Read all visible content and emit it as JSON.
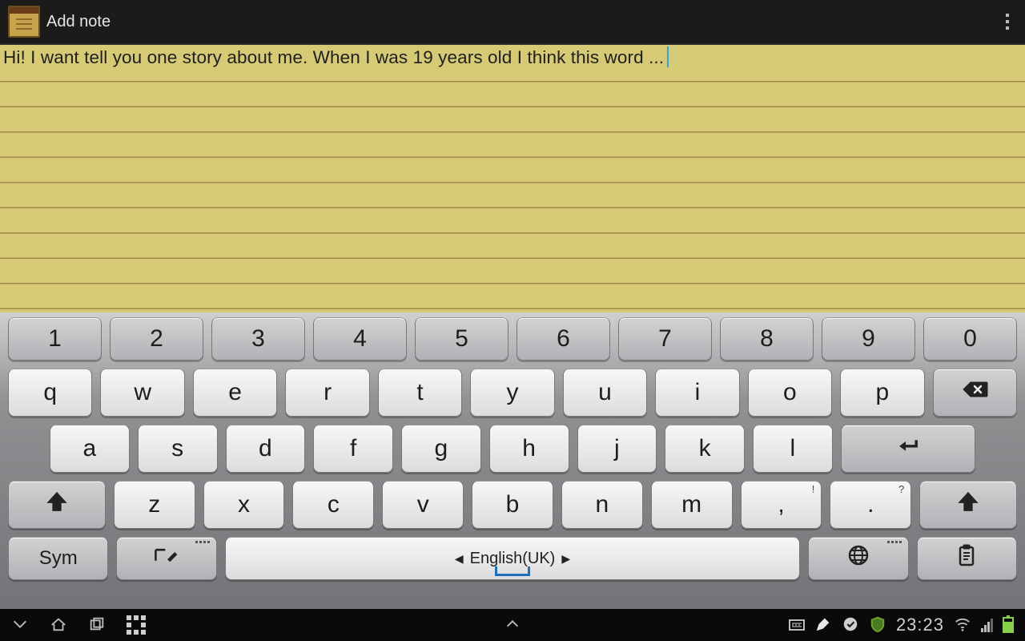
{
  "appbar": {
    "title": "Add note"
  },
  "note": {
    "text": "Hi! I want tell you one story about me. When I was 19 years old I think this word ..."
  },
  "keyboard": {
    "row_num": [
      "1",
      "2",
      "3",
      "4",
      "5",
      "6",
      "7",
      "8",
      "9",
      "0"
    ],
    "row_q": [
      "q",
      "w",
      "e",
      "r",
      "t",
      "y",
      "u",
      "i",
      "o",
      "p"
    ],
    "row_a": [
      "a",
      "s",
      "d",
      "f",
      "g",
      "h",
      "j",
      "k",
      "l"
    ],
    "row_z": [
      "z",
      "x",
      "c",
      "v",
      "b",
      "n",
      "m"
    ],
    "comma_key": ",",
    "comma_hint": "!",
    "period_key": ".",
    "period_hint": "?",
    "sym": "Sym",
    "space_label": "English(UK)"
  },
  "status": {
    "time": "23:23"
  }
}
